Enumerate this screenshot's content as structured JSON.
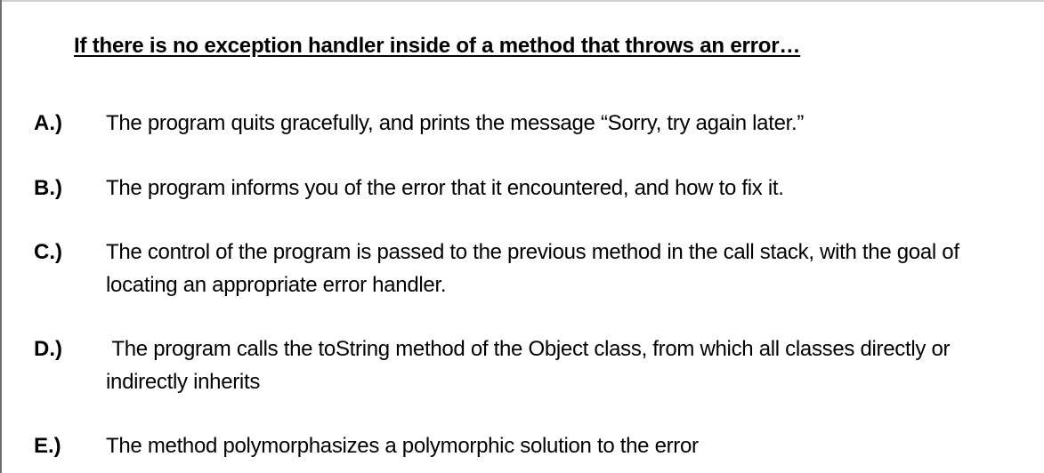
{
  "question": "If there is no exception handler inside of a method that throws an error…",
  "options": [
    {
      "letter": "A.)",
      "text": "The program quits gracefully, and prints the message “Sorry, try again later.”"
    },
    {
      "letter": "B.)",
      "text": "The program informs you of the error that it encountered, and how to fix it."
    },
    {
      "letter": "C.)",
      "text": "The control of the program is passed to the previous method in the call stack, with the goal of locating an appropriate error handler."
    },
    {
      "letter": "D.)",
      "text": " The program calls the toString method of the Object class, from which all classes directly or indirectly inherits"
    },
    {
      "letter": "E.)",
      "text": "The method polymorphasizes a polymorphic solution to the error"
    }
  ]
}
